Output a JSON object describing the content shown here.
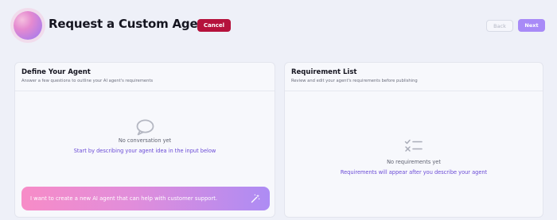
{
  "header": {
    "title": "Request a Custom Agent",
    "cancel_label": "Cancel",
    "back_label": "Back",
    "next_label": "Next"
  },
  "define_panel": {
    "title": "Define Your Agent",
    "subtitle": "Answer a few questions to outline your AI agent's requirements",
    "empty_icon": "chat-bubble-icon",
    "empty_title": "No conversation yet",
    "empty_hint": "Start by describing your agent idea in the input below",
    "input_text": "I want to create a new AI agent that can help with customer support.",
    "input_icon": "magic-wand-icon"
  },
  "requirements_panel": {
    "title": "Requirement List",
    "subtitle": "Review and edit your agent's requirements before publishing",
    "empty_icon": "checklist-icon",
    "empty_title": "No requirements yet",
    "empty_hint": "Requirements will appear after you describe your agent"
  },
  "colors": {
    "background": "#eef0f8",
    "cancel": "#b5123c",
    "next": "#a88af7",
    "hint_link": "#6a4ad6",
    "prompt_gradient_start": "#f78cc7",
    "prompt_gradient_end": "#ad8cf4"
  }
}
